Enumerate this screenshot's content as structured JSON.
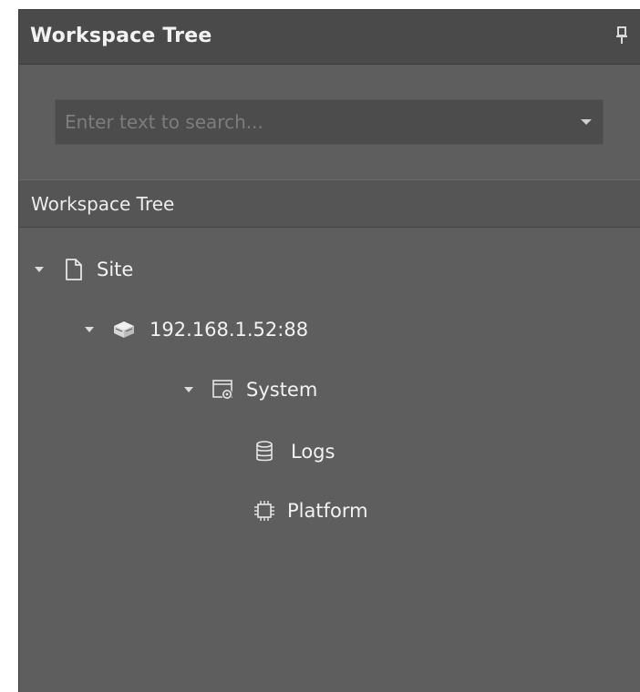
{
  "panel": {
    "title": "Workspace Tree",
    "pin_icon": "pin-icon"
  },
  "search": {
    "placeholder": "Enter text to search...",
    "value": "",
    "dropdown_icon": "chevron-down-icon"
  },
  "tree": {
    "header": "Workspace Tree",
    "nodes": [
      {
        "label": "Site",
        "icon": "document-icon",
        "expanded": true,
        "level": 0
      },
      {
        "label": "192.168.1.52:88",
        "icon": "server-icon",
        "expanded": true,
        "level": 1
      },
      {
        "label": "System",
        "icon": "system-settings-icon",
        "expanded": true,
        "level": 2
      },
      {
        "label": "Logs",
        "icon": "database-icon",
        "expanded": false,
        "level": 3
      },
      {
        "label": "Platform",
        "icon": "chip-icon",
        "expanded": false,
        "level": 3
      }
    ]
  },
  "colors": {
    "panel_bg": "#5e5e5e",
    "titlebar_bg": "#4a4a4a",
    "header_bg": "#555555",
    "text": "#f2f2f2",
    "placeholder": "#7d7d7d"
  }
}
